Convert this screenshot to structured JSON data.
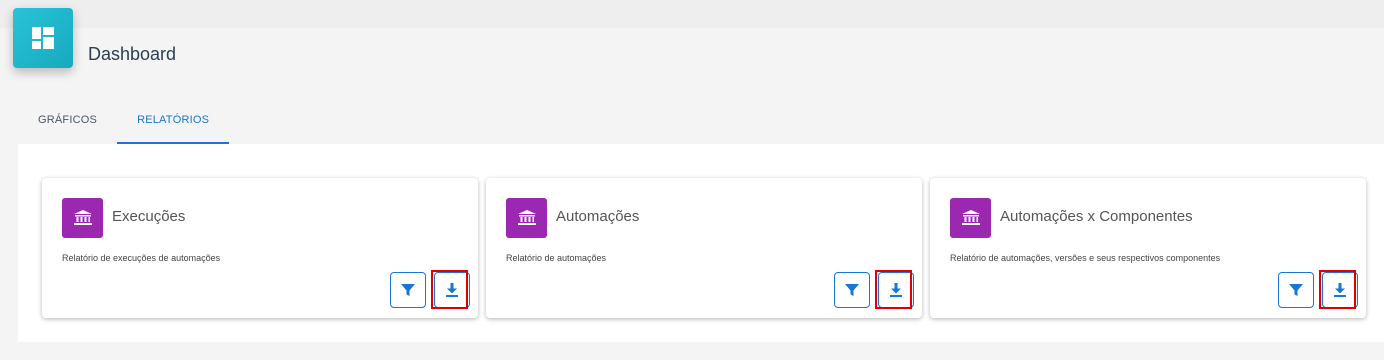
{
  "header": {
    "title": "Dashboard",
    "icon": "dashboard-icon"
  },
  "tabs": [
    {
      "label": "GRÁFICOS",
      "active": false
    },
    {
      "label": "RELATÓRIOS",
      "active": true
    }
  ],
  "colors": {
    "accent": "#1976d2",
    "card_icon_bg": "#9c27b0",
    "app_icon_bg": "#1fb6cb",
    "highlight": "#e00000"
  },
  "reports": [
    {
      "title": "Execuções",
      "description": "Relatório de execuções de automações",
      "icon": "bank-icon",
      "filter_icon": "filter-icon",
      "download_icon": "download-icon"
    },
    {
      "title": "Automações",
      "description": "Relatório de automações",
      "icon": "bank-icon",
      "filter_icon": "filter-icon",
      "download_icon": "download-icon"
    },
    {
      "title": "Automações x Componentes",
      "description": "Relatório de automações, versões e seus respectivos componentes",
      "icon": "bank-icon",
      "filter_icon": "filter-icon",
      "download_icon": "download-icon"
    }
  ]
}
